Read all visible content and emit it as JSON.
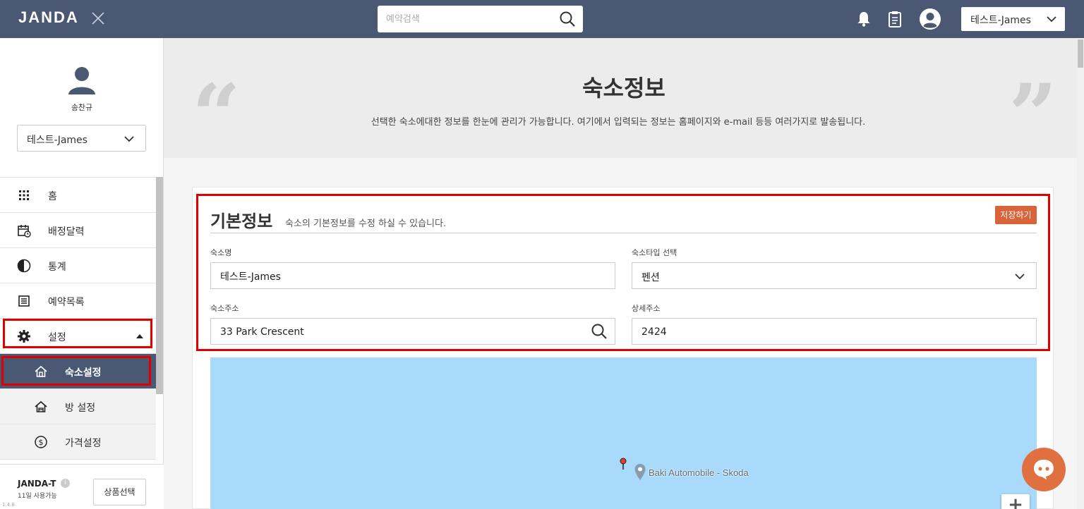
{
  "topbar": {
    "logo": "JANDA",
    "search_placeholder": "예약검색",
    "property_select": "테스트-James"
  },
  "sidebar": {
    "user_name": "송찬규",
    "property_select": "테스트-James",
    "menu": [
      {
        "label": "홈",
        "icon": "grid-icon"
      },
      {
        "label": "배정달력",
        "icon": "calendar-icon"
      },
      {
        "label": "통계",
        "icon": "pie-chart-icon"
      },
      {
        "label": "예약목록",
        "icon": "list-icon"
      },
      {
        "label": "설정",
        "icon": "gear-icon"
      },
      {
        "label": "숙소설정",
        "icon": "house-icon"
      },
      {
        "label": "방 설정",
        "icon": "room-icon"
      },
      {
        "label": "가격설정",
        "icon": "dollar-icon"
      }
    ],
    "plan_name": "JANDA-T",
    "plan_days": "11일 사용가능",
    "plan_button": "상품선택",
    "version": "1.4.8"
  },
  "hero": {
    "title": "숙소정보",
    "description": "선택한 숙소에대한 정보를 한눈에 관리가 가능합니다. 여기에서 입력되는 정보는 홈페이지와 e-mail 등등 여러가지로 발송됩니다."
  },
  "basic_info": {
    "title": "기본정보",
    "description": "숙소의 기본정보를 수정 하실 수 있습니다.",
    "save_label": "저장하기",
    "name_label": "숙소명",
    "name_value": "테스트-James",
    "type_label": "숙소타입 선택",
    "type_value": "펜션",
    "address_label": "숙소주소",
    "address_value": "33 Park Crescent",
    "detail_label": "상세주소",
    "detail_value": "2424"
  },
  "map": {
    "place_label": "Baki Automobile - Skoda",
    "zoom_in": "+"
  },
  "colors": {
    "topbar": "#4b5873",
    "accent": "#d9643a",
    "highlight": "#e00000",
    "map_water": "#a9d9fb"
  }
}
